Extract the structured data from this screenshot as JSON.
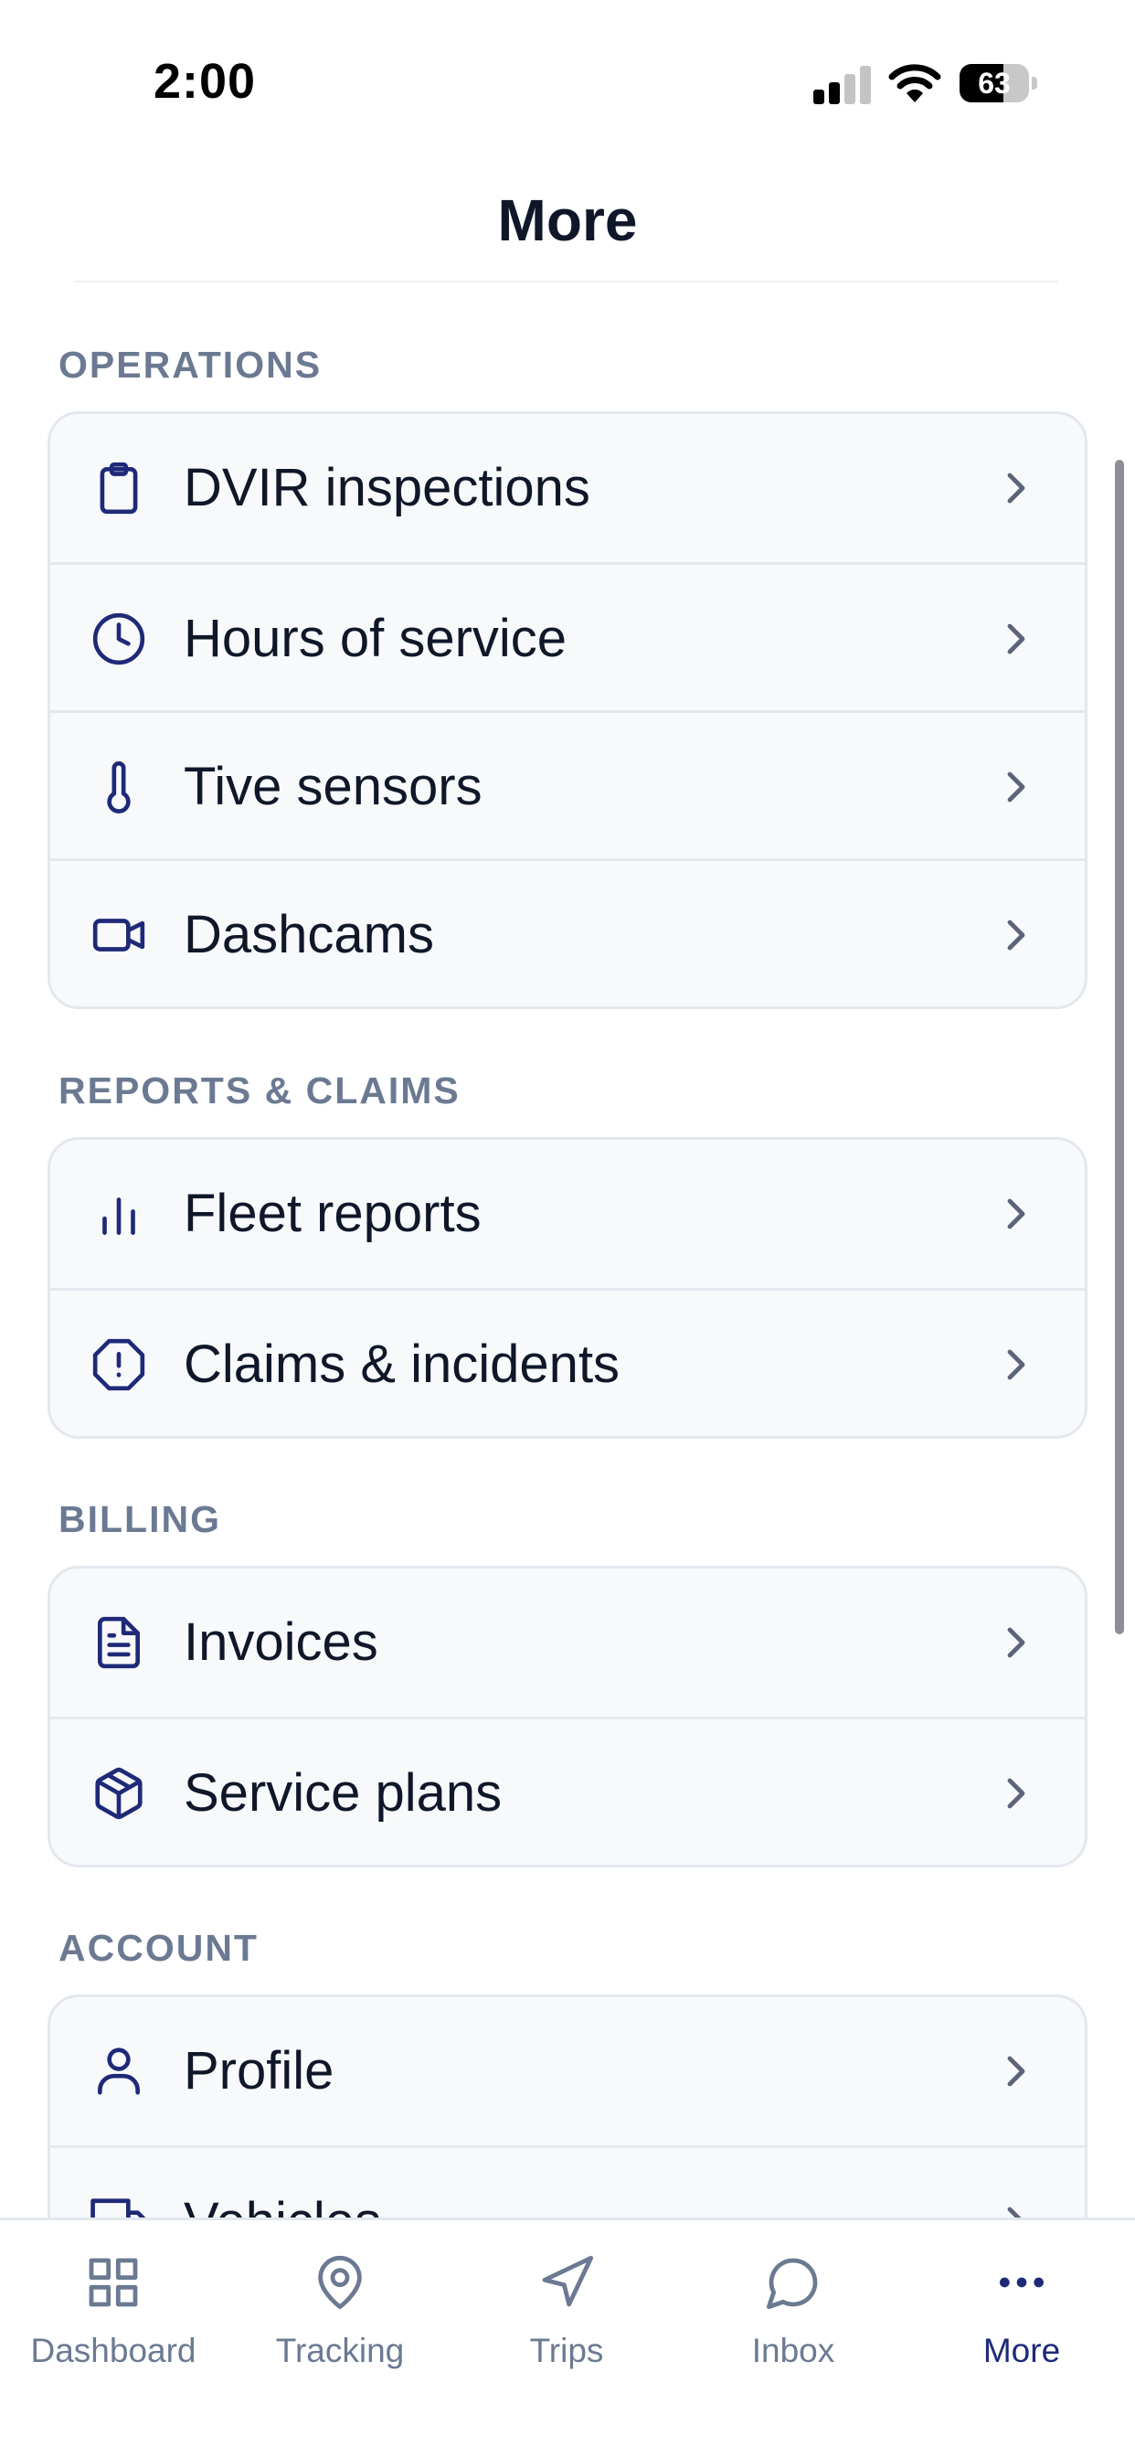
{
  "status_bar": {
    "time": "2:00",
    "battery_percent": "63",
    "battery_level": 0.63,
    "signal_bars_active": 2,
    "signal_bars_total": 4
  },
  "header": {
    "title": "More"
  },
  "sections": [
    {
      "label": "OPERATIONS",
      "items": [
        {
          "label": "DVIR inspections",
          "icon": "clipboard-icon"
        },
        {
          "label": "Hours of service",
          "icon": "clock-icon"
        },
        {
          "label": "Tive sensors",
          "icon": "thermometer-icon"
        },
        {
          "label": "Dashcams",
          "icon": "video-camera-icon"
        }
      ]
    },
    {
      "label": "REPORTS & CLAIMS",
      "items": [
        {
          "label": "Fleet reports",
          "icon": "bar-chart-icon"
        },
        {
          "label": "Claims & incidents",
          "icon": "alert-octagon-icon"
        }
      ]
    },
    {
      "label": "BILLING",
      "items": [
        {
          "label": "Invoices",
          "icon": "document-icon"
        },
        {
          "label": "Service plans",
          "icon": "package-icon"
        }
      ]
    },
    {
      "label": "ACCOUNT",
      "items": [
        {
          "label": "Profile",
          "icon": "user-icon"
        },
        {
          "label": "Vehicles",
          "icon": "truck-icon"
        }
      ]
    }
  ],
  "tab_bar": {
    "tabs": [
      {
        "label": "Dashboard",
        "icon": "grid-icon",
        "active": false
      },
      {
        "label": "Tracking",
        "icon": "map-pin-icon",
        "active": false
      },
      {
        "label": "Trips",
        "icon": "navigation-icon",
        "active": false
      },
      {
        "label": "Inbox",
        "icon": "chat-bubble-icon",
        "active": false
      },
      {
        "label": "More",
        "icon": "more-dots-icon",
        "active": true
      }
    ]
  },
  "colors": {
    "icon_navy": "#1e2a78",
    "text_primary": "#0f1729",
    "section_label": "#6b7a92",
    "card_bg": "#f8f9fb",
    "card_border": "#e3e7ee",
    "chevron": "#5b6478",
    "tab_inactive": "#6b7a92",
    "tab_active": "#1e2a78"
  }
}
